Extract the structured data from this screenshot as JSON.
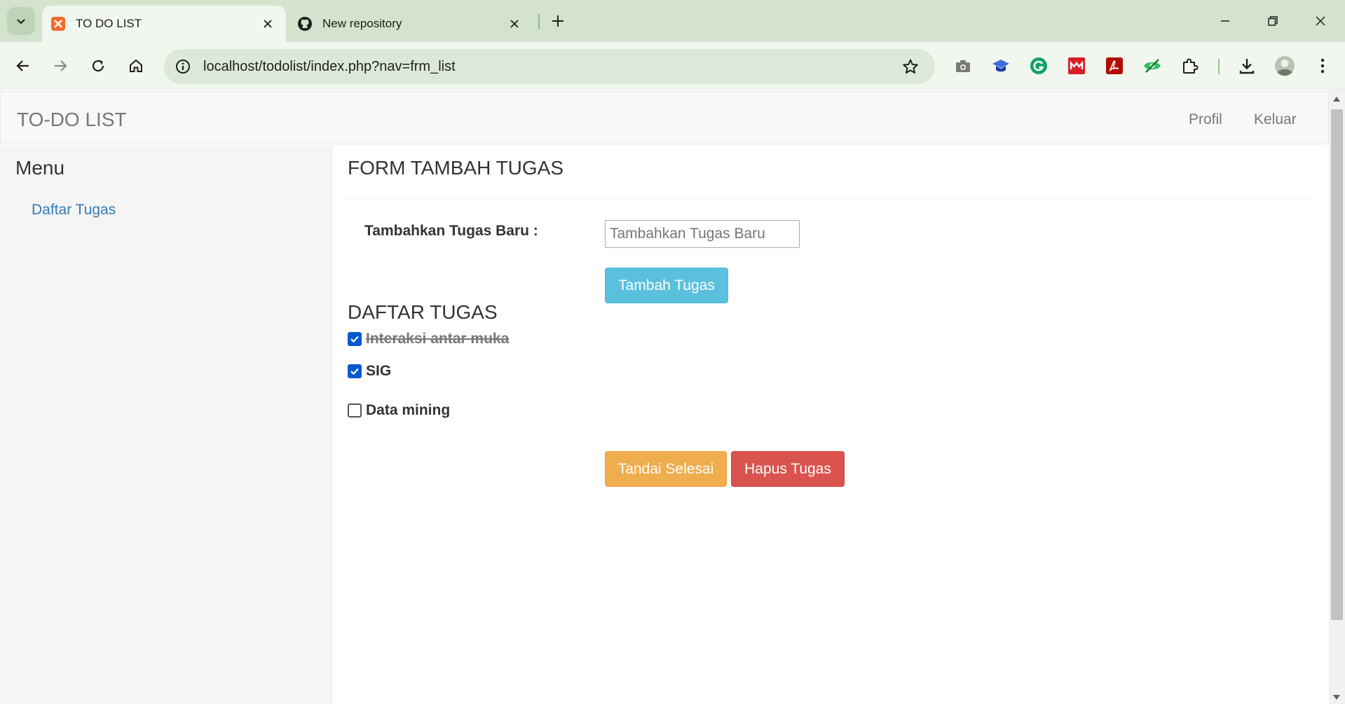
{
  "browser": {
    "tabs": [
      {
        "title": "TO DO LIST",
        "favicon": "xampp-icon",
        "active": true
      },
      {
        "title": "New repository",
        "favicon": "github-icon",
        "active": false
      }
    ],
    "address_bar": {
      "url": "localhost/todolist/index.php?nav=frm_list"
    },
    "extensions": [
      "camera-icon",
      "graduation-cap-icon",
      "grammarly-icon",
      "mendeley-icon",
      "acrobat-icon",
      "eye-slash-icon",
      "puzzle-icon"
    ]
  },
  "navbar": {
    "brand": "TO-DO LIST",
    "links": [
      "Profil",
      "Keluar"
    ]
  },
  "sidebar": {
    "title": "Menu",
    "items": [
      {
        "label": "Daftar Tugas"
      }
    ]
  },
  "form": {
    "title": "FORM TAMBAH TUGAS",
    "label": "Tambahkan Tugas Baru :",
    "input_placeholder": "Tambahkan Tugas Baru",
    "input_value": "",
    "submit_label": "Tambah Tugas"
  },
  "task_list": {
    "title": "DAFTAR TUGAS",
    "tasks": [
      {
        "label": "Interaksi antar muka",
        "checked": true,
        "done": true
      },
      {
        "label": "SIG",
        "checked": true,
        "done": false
      },
      {
        "label": "Data mining",
        "checked": false,
        "done": false
      }
    ],
    "mark_done_label": "Tandai Selesai",
    "delete_label": "Hapus Tugas"
  },
  "colors": {
    "tabbar": "#d3e3cd",
    "toolbar": "#f1f6ee",
    "link": "#337ab7",
    "btn_info": "#5bc0de",
    "btn_warning": "#f0ad4e",
    "btn_danger": "#d9534f",
    "checkbox": "#0b57d0"
  }
}
